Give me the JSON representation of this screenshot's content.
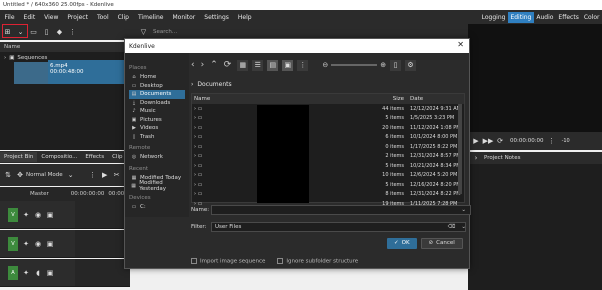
{
  "window_title": "Untitled * / 640x360 25.00fps - Kdenlive",
  "menu": [
    "File",
    "Edit",
    "View",
    "Project",
    "Tool",
    "Clip",
    "Timeline",
    "Monitor",
    "Settings",
    "Help"
  ],
  "layouts": [
    "Logging",
    "Editing",
    "Audio",
    "Effects",
    "Color"
  ],
  "active_layout": "Editing",
  "search_placeholder": "Search...",
  "bin": {
    "header": "Name",
    "folder": "Sequences",
    "clip_name": "6.mp4",
    "clip_duration": "00:00:48:00"
  },
  "bottom_tabs": [
    "Project Bin",
    "Compositio...",
    "Effects",
    "Clip"
  ],
  "timeline": {
    "mode": "Normal Mode",
    "master": "Master",
    "timecodes": [
      "00:00:00:00",
      "00:00:"
    ]
  },
  "monitor": {
    "timecode": "00:00:00:00",
    "scale": "-10"
  },
  "notes_tab": "Project Notes",
  "dialog": {
    "title": "Kdenlive",
    "places": {
      "section_places": "Places",
      "items": [
        "Home",
        "Desktop",
        "Documents",
        "Downloads",
        "Music",
        "Pictures",
        "Videos",
        "Trash"
      ],
      "selected": "Documents",
      "section_remote": "Remote",
      "remote_items": [
        "Network"
      ],
      "section_recent": "Recent",
      "recent_items": [
        "Modified Today",
        "Modified Yesterday"
      ],
      "section_devices": "Devices",
      "device_items": [
        "C:"
      ]
    },
    "breadcrumb": "Documents",
    "columns": {
      "name": "Name",
      "size": "Size",
      "date": "Date"
    },
    "rows": [
      {
        "size": "44 items",
        "date": "12/12/2024 9:31 AM"
      },
      {
        "size": "5 items",
        "date": "1/5/2025 3:23 PM"
      },
      {
        "size": "20 items",
        "date": "11/12/2024 1:08 PM"
      },
      {
        "size": "6 items",
        "date": "10/1/2024 8:00 PM"
      },
      {
        "size": "0 items",
        "date": "1/17/2025 8:22 PM"
      },
      {
        "size": "2 items",
        "date": "12/31/2024 8:57 PM"
      },
      {
        "size": "5 items",
        "date": "10/21/2024 8:34 PM"
      },
      {
        "size": "10 items",
        "date": "12/6/2024 5:20 PM"
      },
      {
        "size": "5 items",
        "date": "12/16/2024 8:20 PM"
      },
      {
        "size": "8 items",
        "date": "12/31/2024 8:22 PM"
      },
      {
        "size": "19 items",
        "date": "1/11/2025 7:28 PM"
      }
    ],
    "name_label": "Name:",
    "name_value": "",
    "filter_label": "Filter:",
    "filter_value": "User Files",
    "ok_label": "OK",
    "cancel_label": "Cancel",
    "opt_import_sequence": "Import image sequence",
    "opt_ignore_subfolder": "Ignore subfolder structure"
  },
  "colors": {
    "accent": "#2f6e99",
    "track_tag": "#3d8a3d",
    "highlight_frame": "#dd2233"
  }
}
